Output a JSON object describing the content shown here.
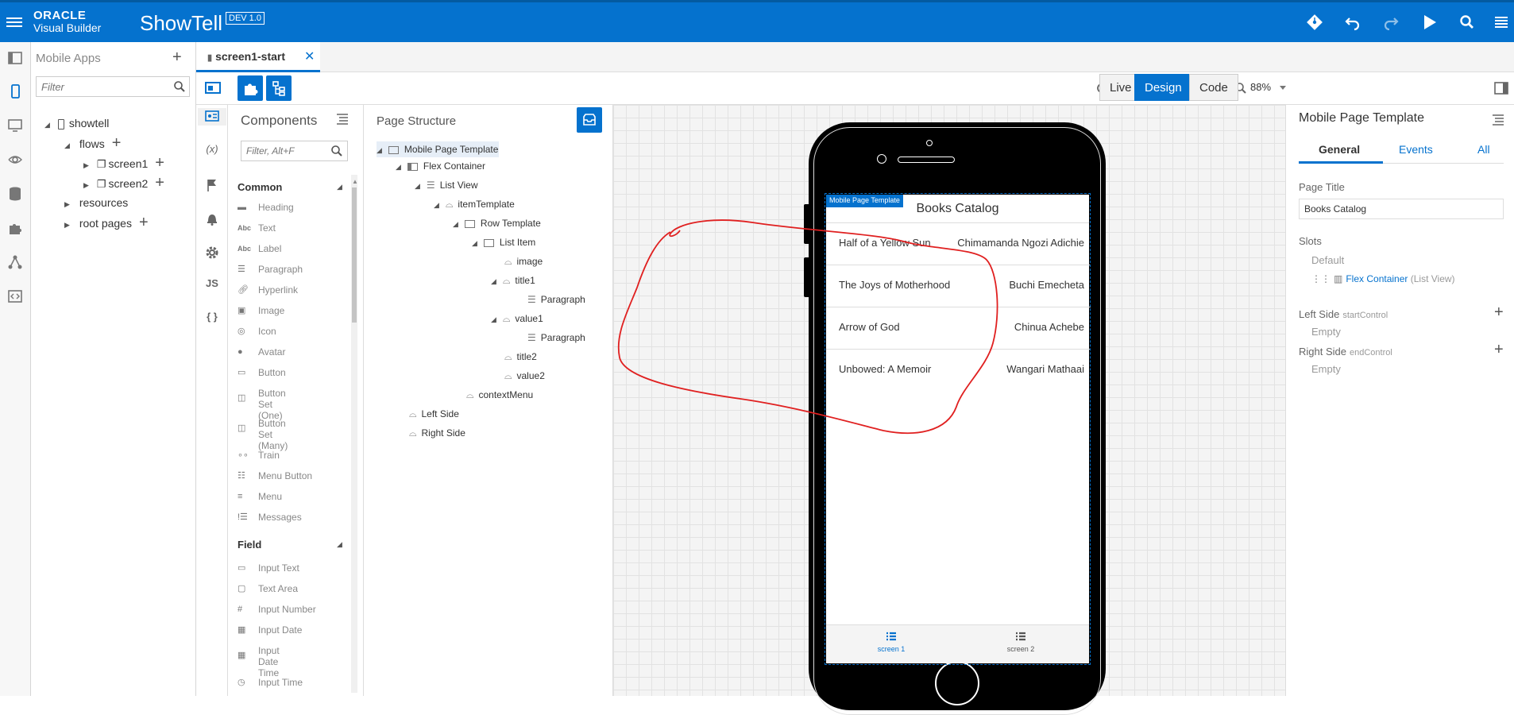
{
  "topbar": {
    "brand_line1": "ORACLE",
    "brand_line2": "Visual Builder",
    "app_name": "ShowTell",
    "env_badge": "DEV 1.0",
    "icons": [
      "git-icon",
      "undo-icon",
      "redo-icon",
      "run-icon",
      "search-icon",
      "menu-icon"
    ]
  },
  "nav": {
    "title": "Mobile Apps",
    "filter_placeholder": "Filter",
    "tree": [
      {
        "label": "showtell"
      },
      {
        "label": "flows"
      },
      {
        "label": "screen1"
      },
      {
        "label": "screen2"
      },
      {
        "label": "resources"
      },
      {
        "label": "root pages"
      }
    ]
  },
  "tabs": [
    {
      "label": "screen1-start"
    }
  ],
  "toolbar": {
    "zoom": "88%",
    "modes": [
      "Live",
      "Design",
      "Code"
    ],
    "active_mode": "Design"
  },
  "iconcol": {
    "variables": "(x)",
    "js": "JS",
    "json": "{ }"
  },
  "components": {
    "title": "Components",
    "filter_placeholder": "Filter, Alt+F",
    "sections": [
      {
        "label": "Common",
        "items": [
          "Heading",
          "Text",
          "Label",
          "Paragraph",
          "Hyperlink",
          "Image",
          "Icon",
          "Avatar",
          "Button",
          "Button Set (One)",
          "Button Set (Many)",
          "Train",
          "Menu Button",
          "Menu",
          "Messages"
        ]
      },
      {
        "label": "Field",
        "items": [
          "Input Text",
          "Text Area",
          "Input Number",
          "Input Date",
          "Input Date Time",
          "Input Time"
        ]
      }
    ]
  },
  "structure": {
    "title": "Page Structure",
    "items": [
      {
        "label": "Mobile Page Template",
        "depth": 0,
        "selected": true
      },
      {
        "label": "Flex Container",
        "depth": 1
      },
      {
        "label": "List View",
        "depth": 2
      },
      {
        "label": "itemTemplate",
        "depth": 3
      },
      {
        "label": "Row Template",
        "depth": 4
      },
      {
        "label": "List Item",
        "depth": 5
      },
      {
        "label": "image",
        "depth": 6
      },
      {
        "label": "title1",
        "depth": 6
      },
      {
        "label": "Paragraph",
        "depth": 7
      },
      {
        "label": "value1",
        "depth": 6
      },
      {
        "label": "Paragraph",
        "depth": 7
      },
      {
        "label": "title2",
        "depth": 6
      },
      {
        "label": "value2",
        "depth": 6
      },
      {
        "label": "contextMenu",
        "depth": 4
      },
      {
        "label": "Left Side",
        "depth": 1
      },
      {
        "label": "Right Side",
        "depth": 1
      }
    ]
  },
  "preview": {
    "template_tag": "Mobile Page Template",
    "page_title": "Books Catalog",
    "books": [
      {
        "title": "Half of a Yellow Sun",
        "author": "Chimamanda Ngozi Adichie"
      },
      {
        "title": "The Joys of Motherhood",
        "author": "Buchi Emecheta"
      },
      {
        "title": "Arrow of God",
        "author": "Chinua Achebe"
      },
      {
        "title": "Unbowed: A Memoir",
        "author": "Wangari Mathaai"
      }
    ],
    "bottom_nav": [
      "screen 1",
      "screen 2"
    ]
  },
  "props": {
    "title": "Mobile Page Template",
    "tabs": [
      "General",
      "Events",
      "All"
    ],
    "page_title_label": "Page Title",
    "page_title_value": "Books Catalog",
    "slots_label": "Slots",
    "default_label": "Default",
    "default_slot_name": "Flex Container",
    "default_slot_type": "(List View)",
    "left_side_label": "Left Side",
    "left_side_sub": "startControl",
    "left_side_value": "Empty",
    "right_side_label": "Right Side",
    "right_side_sub": "endControl",
    "right_side_value": "Empty"
  },
  "colors": {
    "accent": "#0572ce",
    "annotation": "#e02020"
  }
}
